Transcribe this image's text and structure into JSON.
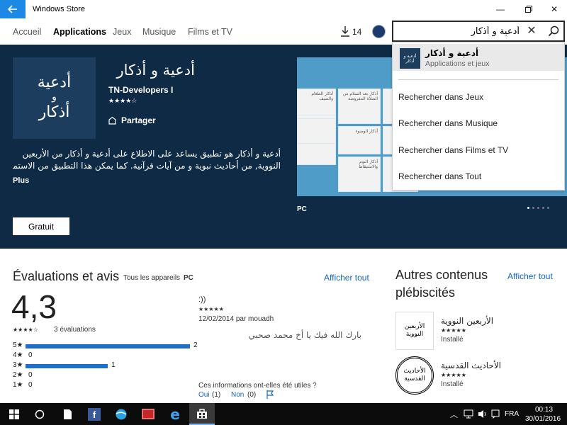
{
  "window": {
    "title": "Windows Store"
  },
  "nav": {
    "items": [
      "Accueil",
      "Applications",
      "Jeux",
      "Musique",
      "Films et TV"
    ],
    "active": "Applications",
    "downloads_count": "14"
  },
  "search": {
    "value": "أدعية و أذكار"
  },
  "dropdown": {
    "app_name": "أدعية و أذكار",
    "app_category": "Applications et jeux",
    "app_icon_text": "أدعية و أذكار",
    "items": [
      "Rechercher dans Jeux",
      "Rechercher dans Musique",
      "Rechercher dans Films et TV",
      "Rechercher dans Tout"
    ]
  },
  "app": {
    "logo_line1": "أدعية",
    "logo_line2": "و",
    "logo_line3": "أذكار",
    "title": "أدعية و أذكار",
    "developer": "TN-Developers I",
    "stars": "★★★★☆",
    "share_label": "Partager",
    "description_line1": "أدعية و أذكار هو تطبيق يساعد على الاطلاع على  أدعية و أذكار من الأربعين",
    "description_line2": "النووية, من أحاديث نبوية و من آيات قرآنية. كما يمكن هذا التطبيق من الاستماع...",
    "more_label": "Plus",
    "button_label": "Gratuit",
    "platform_label": "PC"
  },
  "screenshot_tiles": {
    "t1": "أذكار الطعام والضيف",
    "t2": "أذكار بعد السلام من الصلاة المفروضة",
    "t3": "أذكار الوضوء",
    "t4": "أذكار النوم والاستيقاظ"
  },
  "ratings": {
    "title": "Évaluations et avis",
    "device_filter": "Tous les appareils",
    "device_selected": "PC",
    "show_all": "Afficher tout",
    "average": "4,3",
    "stars": "★★★★☆",
    "count_label": "3 évaluations",
    "distribution": [
      {
        "label": "5★",
        "count": 2
      },
      {
        "label": "4★",
        "count": 0
      },
      {
        "label": "3★",
        "count": 1
      },
      {
        "label": "2★",
        "count": 0
      },
      {
        "label": "1★",
        "count": 0
      }
    ]
  },
  "review": {
    "title": ":))",
    "stars": "★★★★★",
    "meta": "12/02/2014 par mouadh",
    "text": "بارك الله فيك يا أخ محمد صحبي",
    "helpful_question": "Ces informations ont-elles été utiles ?",
    "yes_label": "Oui",
    "yes_count": "(1)",
    "no_label": "Non",
    "no_count": "(0)"
  },
  "other": {
    "title_line1": "Autres contenus",
    "title_line2": "plébiscités",
    "show_all": "Afficher tout",
    "items": [
      {
        "title": "الأربعين النووية",
        "stars": "★★★★★",
        "status": "Installé",
        "icon_text": "الأربعين النووية"
      },
      {
        "title": "الأحاديث القدسية",
        "stars": "★★★★★",
        "status": "Installé",
        "icon_text": "الأحاديث القدسية"
      }
    ]
  },
  "taskbar": {
    "language": "FRA",
    "time": "00:13",
    "date": "30/01/2016"
  },
  "colors": {
    "hero_bg": "#0e2a45",
    "accent": "#1e88e5",
    "link": "#1565c0",
    "bar": "#1e6fc9"
  }
}
